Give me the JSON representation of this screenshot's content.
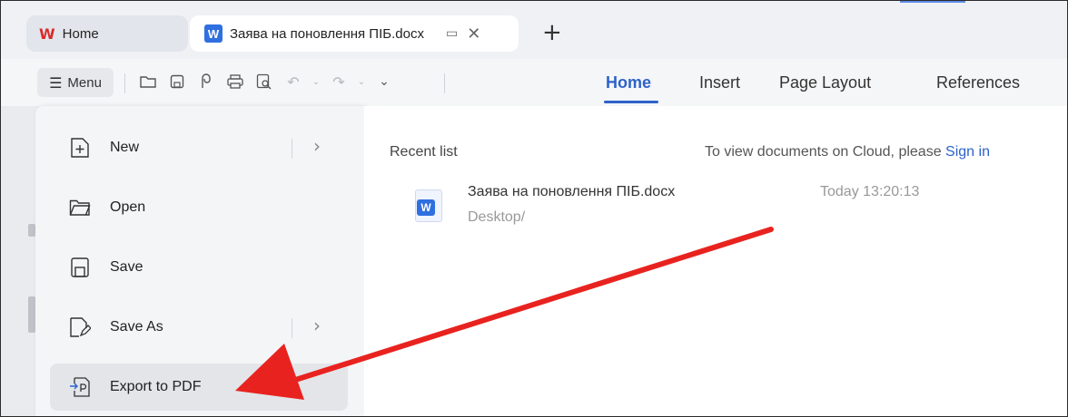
{
  "tabs": {
    "home_label": "Home",
    "doc_label": "Заява на поновлення ПІБ.docx",
    "doc_badge": "W",
    "home_logo": "W"
  },
  "toolbar": {
    "menu_label": "Menu",
    "ribbon_tabs": [
      "Home",
      "Insert",
      "Page Layout",
      "References"
    ],
    "active_tab": "Home"
  },
  "file_menu": {
    "items": [
      {
        "label": "New",
        "icon": "new-doc-icon",
        "has_submenu": true
      },
      {
        "label": "Open",
        "icon": "folder-icon",
        "has_submenu": false
      },
      {
        "label": "Save",
        "icon": "save-icon",
        "has_submenu": false
      },
      {
        "label": "Save As",
        "icon": "save-as-icon",
        "has_submenu": true
      },
      {
        "label": "Export to PDF",
        "icon": "export-pdf-icon",
        "has_submenu": false,
        "highlighted": true
      }
    ]
  },
  "recent": {
    "heading": "Recent list",
    "cloud_prompt": "To view documents on Cloud, please",
    "cloud_link": "Sign in",
    "files": [
      {
        "name": "Заява на поновлення ПІБ.docx",
        "path": "Desktop/",
        "time": "Today 13:20:13",
        "badge": "W"
      }
    ]
  },
  "colors": {
    "accent": "#2d63c8",
    "wps_red": "#d92b2b",
    "doc_blue": "#2f6fe0",
    "annotation_arrow": "#e8231f"
  }
}
